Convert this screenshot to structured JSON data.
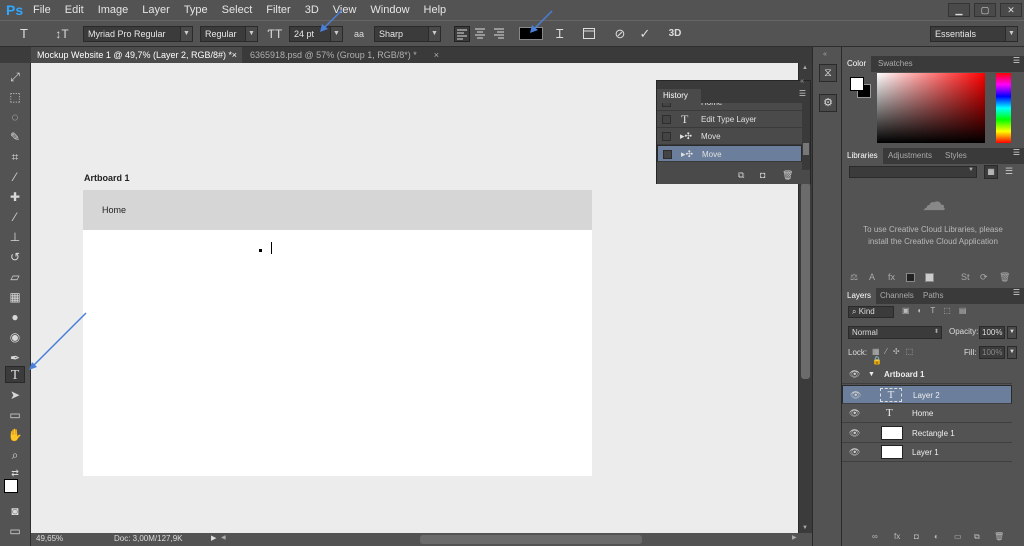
{
  "app": {
    "logo": "Ps"
  },
  "menu": [
    "File",
    "Edit",
    "Image",
    "Layer",
    "Type",
    "Select",
    "Filter",
    "3D",
    "View",
    "Window",
    "Help"
  ],
  "options": {
    "font_family": "Myriad Pro Regular",
    "font_style": "Regular",
    "font_size": "24 pt",
    "aa_label": "aa",
    "antialias": "Sharp",
    "workspace": "Essentials",
    "threeD": "3D"
  },
  "tabs": [
    {
      "label": "Mockup Website 1 @ 49,7% (Layer 2, RGB/8#) *",
      "close": "×"
    },
    {
      "label": "6365918.psd @ 57% (Group 1, RGB/8*) *",
      "close": "×"
    }
  ],
  "canvas": {
    "artboard_label": "Artboard 1",
    "header_text": "Home"
  },
  "history": {
    "title": "History",
    "items": [
      {
        "label": "Home",
        "selected": false
      },
      {
        "label": "Edit Type Layer",
        "selected": false
      },
      {
        "label": "Move",
        "selected": false
      },
      {
        "label": "Move",
        "selected": true
      }
    ]
  },
  "color_panel": {
    "tabs": [
      "Color",
      "Swatches"
    ]
  },
  "libraries": {
    "tabs": [
      "Libraries",
      "Adjustments",
      "Styles"
    ],
    "message": "To use Creative Cloud Libraries, please install the Creative Cloud Application"
  },
  "layers": {
    "tabs": [
      "Layers",
      "Channels",
      "Paths"
    ],
    "kind_label": "Kind",
    "blend_mode": "Normal",
    "opacity_label": "Opacity:",
    "opacity": "100%",
    "lock_label": "Lock:",
    "fill_label": "Fill:",
    "fill": "100%",
    "items": [
      {
        "name": "Artboard 1",
        "type": "artboard",
        "selected": false
      },
      {
        "name": "Layer 2",
        "type": "text",
        "selected": true
      },
      {
        "name": "Home",
        "type": "text",
        "selected": false
      },
      {
        "name": "Rectangle 1",
        "type": "shape",
        "selected": false
      },
      {
        "name": "Layer 1",
        "type": "pixel",
        "selected": false
      }
    ]
  },
  "status": {
    "zoom": "49,65%",
    "doc": "Doc: 3,00M/127,9K"
  },
  "colors": {
    "accent": "#31a8ff",
    "selection": "#6b7e9b",
    "annotation_arrow": "#4a7fd8"
  }
}
